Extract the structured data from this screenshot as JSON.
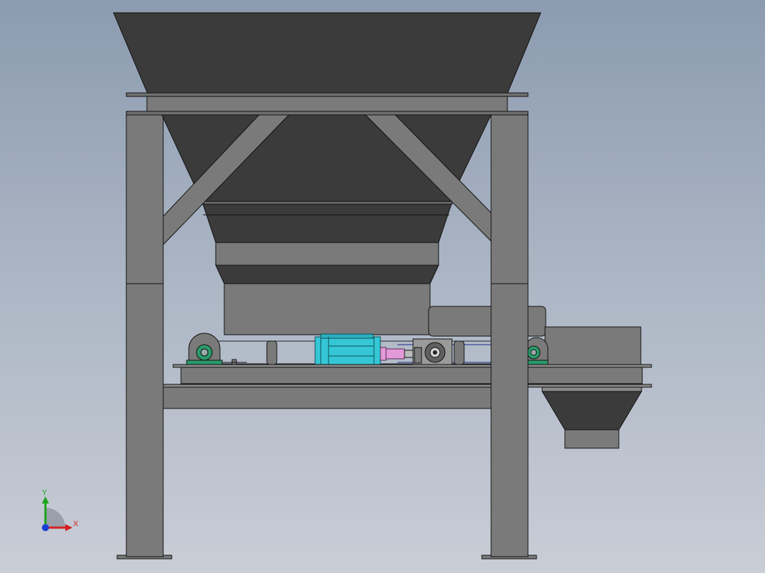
{
  "viewport": {
    "background_top": "#8c9bb0",
    "background_bottom": "#c9cdd6"
  },
  "model": {
    "steel_color": "#7a7a7a",
    "hopper_color": "#3b3b3b",
    "edge_color": "#111111",
    "motor_color": "#35c7d6",
    "coupling_color": "#e39ad8",
    "bearing_color": "#2a9a6a"
  },
  "triad": {
    "x_label": "X",
    "y_label": "Y",
    "x_color": "#d42020",
    "y_color": "#1aa41a",
    "z_color": "#1a3fd4"
  }
}
